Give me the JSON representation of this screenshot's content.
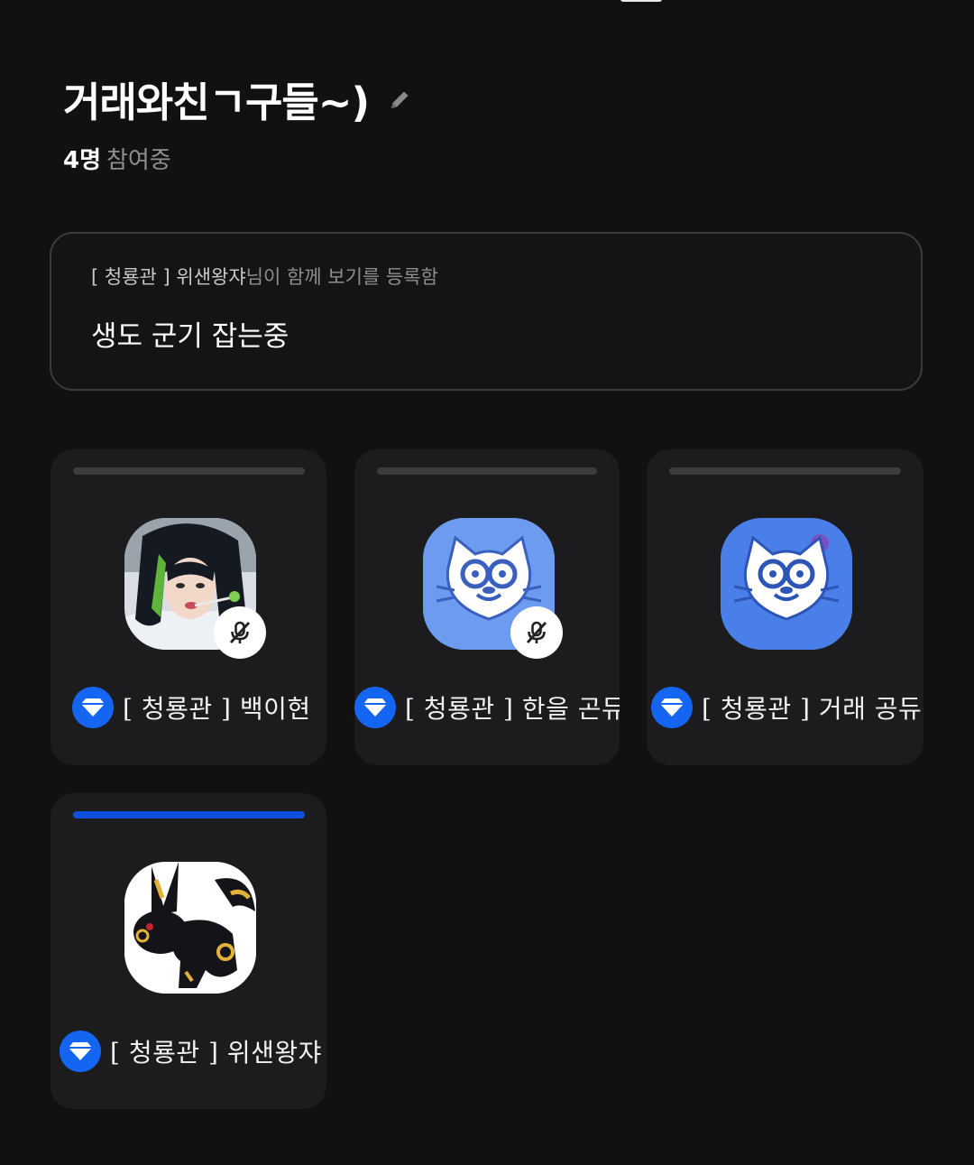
{
  "header": {
    "title": "거래와친ㄱ구들~)",
    "participant_count": "4명",
    "participant_label": "참여중"
  },
  "notice": {
    "registrant": "[ 청룡관 ] 위샌왕쟈",
    "registrant_suffix": "님이 함께 보기를 등록함",
    "message": "생도 군기 잡는중"
  },
  "members": [
    {
      "name": "[ 청룡관 ] 백이현",
      "muted": true,
      "speaking": false,
      "avatar": "girl-photo-avatar"
    },
    {
      "name": "[ 청룡관 ] 한을 곤듀",
      "muted": true,
      "speaking": false,
      "avatar": "cat-mascot-avatar"
    },
    {
      "name": "[ 청룡관 ] 거래 공듀",
      "muted": false,
      "speaking": false,
      "avatar": "cat-mascot-avatar"
    },
    {
      "name": "[ 청룡관 ] 위샌왕쟈",
      "muted": false,
      "speaking": true,
      "avatar": "umbreon-avatar"
    }
  ],
  "colors": {
    "background": "#111112",
    "card": "#1c1c1e",
    "accent_blue": "#1466f2",
    "speaking_bar": "#0f4fe0",
    "muted_text": "#8e8e93"
  }
}
